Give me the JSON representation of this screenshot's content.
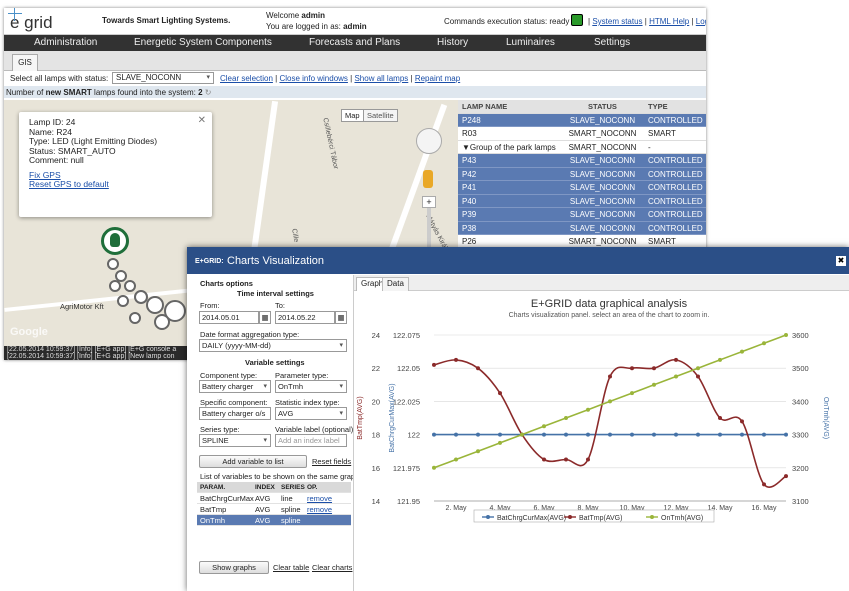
{
  "app": {
    "tagline": "Towards Smart Lighting Systems.",
    "logo": "e grid",
    "welcome_prefix": "Welcome ",
    "user": "admin",
    "logged_in": "You are logged in as: ",
    "cmd_status": "Commands execution status: ready",
    "status_link": "System status",
    "help_link": "HTML Help",
    "logout": "Log"
  },
  "menu": [
    "Administration",
    "Energetic System Components",
    "Forecasts and Plans",
    "History",
    "Luminaires",
    "Settings"
  ],
  "tab": "GIS",
  "select": {
    "label": "Select all lamps with status:",
    "value": "SLAVE_NOCONN",
    "links": [
      "Clear selection",
      "Close info windows",
      "Show all lamps",
      "Repaint map"
    ]
  },
  "count": {
    "pre": "Number of ",
    "bold": "new SMART",
    "post": " lamps found into the system: ",
    "n": "2"
  },
  "map": {
    "map_btn": "Map",
    "sat_btn": "Satellite",
    "road1": "Csillebérci Tábor",
    "road2": "Cille",
    "road3": "Mátyás Király",
    "place": "AgriMotor Kft",
    "google": "Google"
  },
  "popup": {
    "id": "Lamp ID: 24",
    "name": "Name: R24",
    "type": "Type: LED (Light Emitting Diodes)",
    "status": "Status: SMART_AUTO",
    "comment": "Comment: null",
    "fix": "Fix GPS",
    "reset": "Reset GPS to default"
  },
  "log": [
    "[22.05.2014 10:59:37] [Info] [E+G app] [E+G console a",
    "[22.05.2014 10:59:37] [Info] [E+G app] [New lamp con"
  ],
  "lamps": {
    "headers": [
      "LAMP NAME",
      "STATUS",
      "TYPE"
    ],
    "rows": [
      {
        "name": "P248",
        "status": "SLAVE_NOCONN",
        "type": "CONTROLLED",
        "sel": true
      },
      {
        "name": "R03",
        "status": "SMART_NOCONN",
        "type": "SMART",
        "sel": false
      },
      {
        "name": "▼Group of the park lamps",
        "status": "SMART_NOCONN",
        "type": "-",
        "sel": false
      },
      {
        "name": "P43",
        "status": "SLAVE_NOCONN",
        "type": "CONTROLLED",
        "sel": true
      },
      {
        "name": "P42",
        "status": "SLAVE_NOCONN",
        "type": "CONTROLLED",
        "sel": true
      },
      {
        "name": "P41",
        "status": "SLAVE_NOCONN",
        "type": "CONTROLLED",
        "sel": true
      },
      {
        "name": "P40",
        "status": "SLAVE_NOCONN",
        "type": "CONTROLLED",
        "sel": true
      },
      {
        "name": "P39",
        "status": "SLAVE_NOCONN",
        "type": "CONTROLLED",
        "sel": true
      },
      {
        "name": "P38",
        "status": "SLAVE_NOCONN",
        "type": "CONTROLLED",
        "sel": true
      },
      {
        "name": "P26",
        "status": "SMART_NOCONN",
        "type": "SMART",
        "sel": false
      }
    ]
  },
  "dialog": {
    "title_small": "E+GRID:",
    "title": "Charts Visualization",
    "close": "✖"
  },
  "options": {
    "head": "Charts options",
    "time": "Time interval settings",
    "from_l": "From:",
    "to_l": "To:",
    "from": "2014.05.01",
    "to": "2014.05.22",
    "fmt_l": "Date format aggregation type:",
    "fmt": "DAILY (yyyy-MM-dd)",
    "var": "Variable settings",
    "comp_l": "Component type:",
    "comp": "Battery charger",
    "param_l": "Parameter type:",
    "param": "OnTmh",
    "spec_l": "Specific component:",
    "spec": "Battery charger o/s",
    "stat_l": "Statistic index type:",
    "stat": "AVG",
    "ser_l": "Series type:",
    "ser": "SPLINE",
    "vlab_l": "Variable label (optional):",
    "vlab_ph": "Add an index label",
    "add": "Add variable to list",
    "reset": "Reset fields",
    "list_l": "List of variables to be shown on the same graph",
    "cols": [
      "PARAM.",
      "INDEX",
      "SERIES",
      "OP."
    ],
    "vars": [
      {
        "p": "BatChrgCurMax",
        "i": "AVG",
        "s": "line",
        "o": "remove",
        "sel": false
      },
      {
        "p": "BatTmp",
        "i": "AVG",
        "s": "spline",
        "o": "remove",
        "sel": false
      },
      {
        "p": "OnTmh",
        "i": "AVG",
        "s": "spline",
        "o": "",
        "sel": true
      }
    ],
    "show": "Show graphs",
    "clear_t": "Clear table",
    "clear_c": "Clear charts"
  },
  "ctabs": [
    "Graph",
    "Data"
  ],
  "colors": {
    "blue": "#4572a7",
    "red": "#8b2a2a",
    "green": "#9ab53a"
  },
  "chart_data": {
    "type": "line",
    "title": "E+GRID data graphical analysis",
    "subtitle": "Charts visualization panel. select an area of the chart to zoom in.",
    "x_ticks": [
      "2. May",
      "4. May",
      "6. May",
      "8. May",
      "10. May",
      "12. May",
      "14. May",
      "16. May"
    ],
    "y_left_outer": {
      "label": "BatTmp(AVG)",
      "ticks": [
        "24",
        "22",
        "20",
        "18",
        "16",
        "14"
      ]
    },
    "y_left_inner": {
      "label": "BatChrgCurMax(AVG)",
      "ticks": [
        "122.075",
        "122.05",
        "122.025",
        "122",
        "121.975",
        "121.95"
      ]
    },
    "y_right": {
      "label": "OnTmh(AVG)",
      "ticks": [
        "3600",
        "3500",
        "3400",
        "3300",
        "3200",
        "3100"
      ]
    },
    "x_days": [
      1,
      2,
      3,
      4,
      5,
      6,
      7,
      8,
      9,
      10,
      11,
      12,
      13,
      14,
      15,
      16,
      17
    ],
    "series": [
      {
        "name": "BatChrgCurMax(AVG)",
        "axis": "inner",
        "values": [
          122,
          122,
          122,
          122,
          122,
          122,
          122,
          122,
          122,
          122,
          122,
          122,
          122,
          122,
          122,
          122,
          122
        ]
      },
      {
        "name": "BatTmp(AVG)",
        "axis": "outer",
        "values": [
          22.2,
          22.5,
          22.0,
          20.5,
          18.0,
          16.5,
          16.5,
          16.5,
          21.5,
          22.0,
          22.0,
          22.5,
          21.5,
          19.0,
          18.8,
          15.0,
          15.5
        ]
      },
      {
        "name": "OnTmh(AVG)",
        "axis": "right",
        "values": [
          3200,
          3225,
          3250,
          3275,
          3300,
          3325,
          3350,
          3375,
          3400,
          3425,
          3450,
          3475,
          3500,
          3525,
          3550,
          3575,
          3600
        ]
      }
    ]
  }
}
